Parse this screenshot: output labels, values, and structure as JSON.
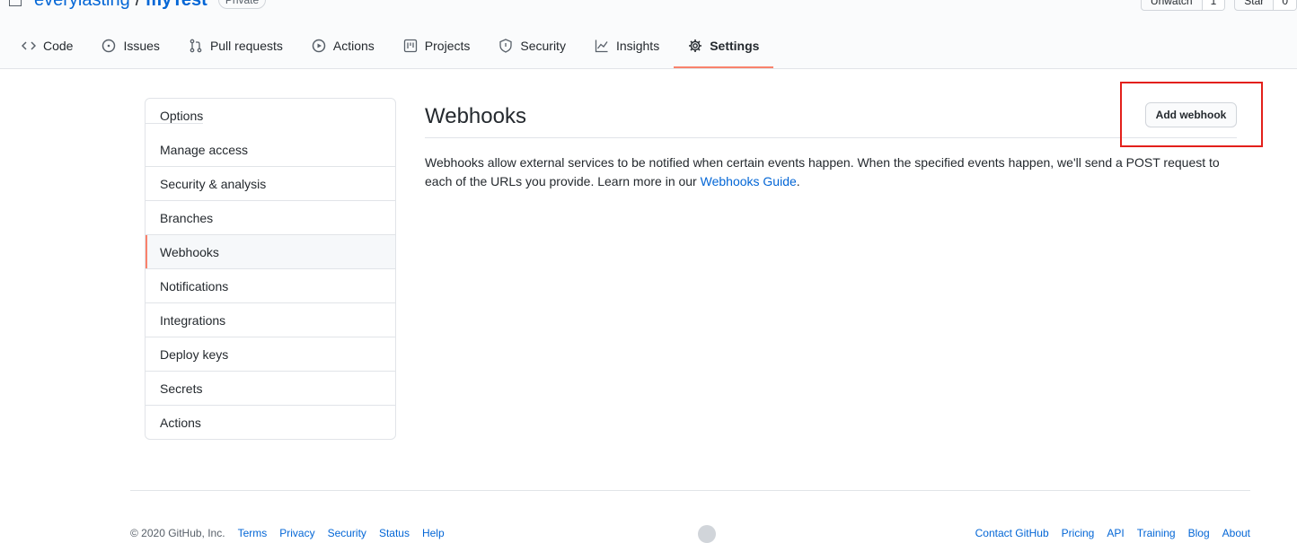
{
  "repo": {
    "owner": "everylasting",
    "separator": "/",
    "name": "myTest",
    "visibility": "Private"
  },
  "head_actions": {
    "watch_label": "Unwatch",
    "watch_count": "1",
    "star_label": "Star",
    "star_count": "0"
  },
  "tabs": [
    {
      "label": "Code",
      "icon": "code-icon"
    },
    {
      "label": "Issues",
      "icon": "issue-icon"
    },
    {
      "label": "Pull requests",
      "icon": "pull-request-icon"
    },
    {
      "label": "Actions",
      "icon": "play-icon"
    },
    {
      "label": "Projects",
      "icon": "project-icon"
    },
    {
      "label": "Security",
      "icon": "shield-icon"
    },
    {
      "label": "Insights",
      "icon": "graph-icon"
    },
    {
      "label": "Settings",
      "icon": "gear-icon",
      "selected": true
    }
  ],
  "sidebar": {
    "items": [
      {
        "label": "Options"
      },
      {
        "label": "Manage access"
      },
      {
        "label": "Security & analysis"
      },
      {
        "label": "Branches"
      },
      {
        "label": "Webhooks",
        "selected": true
      },
      {
        "label": "Notifications"
      },
      {
        "label": "Integrations"
      },
      {
        "label": "Deploy keys"
      },
      {
        "label": "Secrets"
      },
      {
        "label": "Actions"
      }
    ]
  },
  "main": {
    "title": "Webhooks",
    "add_button": "Add webhook",
    "description_before": "Webhooks allow external services to be notified when certain events happen. When the specified events happen, we'll send a POST request to each of the URLs you provide. Learn more in our ",
    "guide_link": "Webhooks Guide",
    "description_after": "."
  },
  "footer": {
    "left": [
      "© 2020 GitHub, Inc.",
      "Terms",
      "Privacy",
      "Security",
      "Status",
      "Help"
    ],
    "right": [
      "Contact GitHub",
      "Pricing",
      "API",
      "Training",
      "Blog",
      "About"
    ]
  },
  "colors": {
    "accent": "#f9826c",
    "link": "#0366d6",
    "annotation": "#e3201b"
  }
}
